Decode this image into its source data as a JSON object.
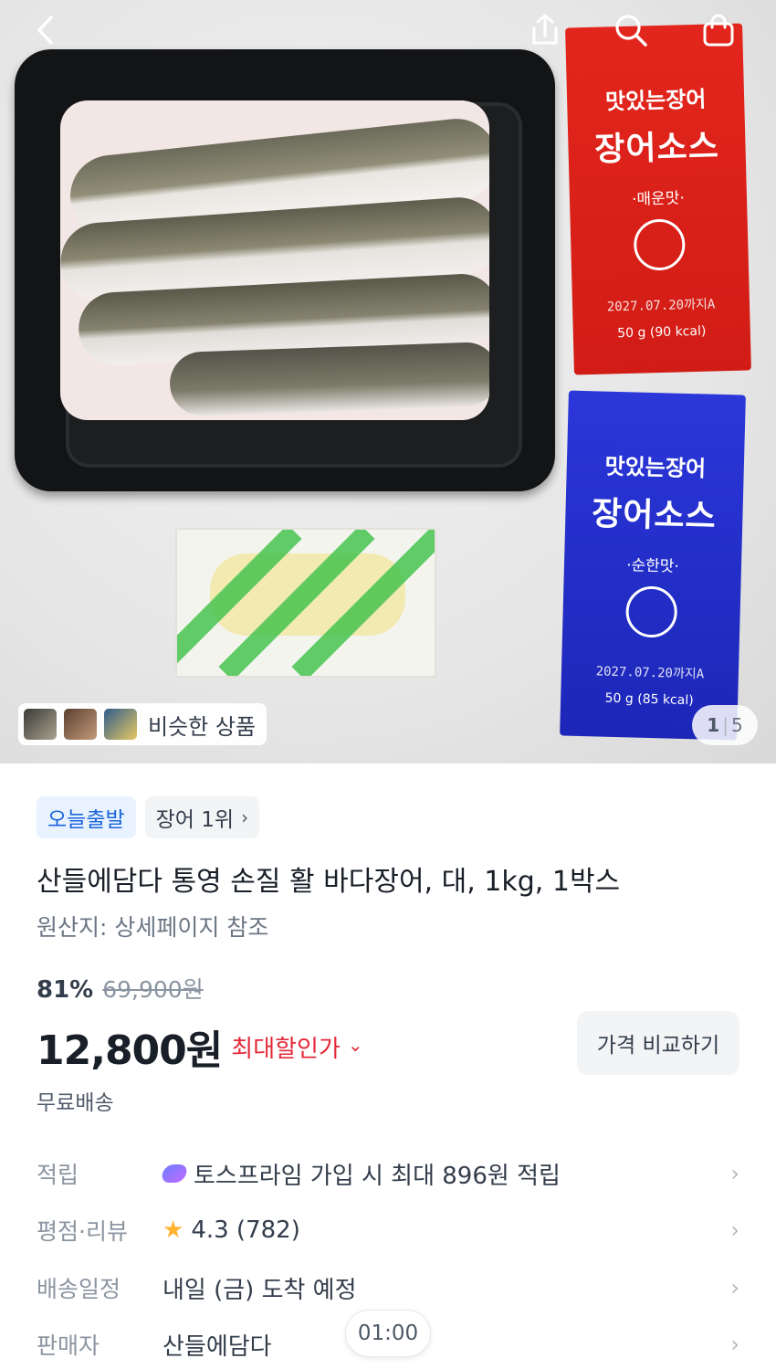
{
  "gallery": {
    "similar_label": "비슷한 상품",
    "counter_current": "1",
    "counter_total": "5",
    "red_sauce": {
      "brand": "맛있는장어",
      "name": "장어소스",
      "flavor": "·매운맛·",
      "expiry": "2027.07.20까지A",
      "weight": "50 g (90 kcal)"
    },
    "blue_sauce": {
      "brand": "맛있는장어",
      "name": "장어소스",
      "flavor": "·순한맛·",
      "expiry": "2027.07.20까지A",
      "weight": "50 g (85 kcal)"
    }
  },
  "tags": {
    "today_ship": "오늘출발",
    "rank": "장어 1위"
  },
  "product": {
    "title": "산들에담다 통영 손질 활 바다장어, 대, 1kg, 1박스",
    "origin": "원산지: 상세페이지 참조",
    "discount_rate": "81%",
    "original_price": "69,900원",
    "price": "12,800원",
    "max_discount_label": "최대할인가",
    "compare_button": "가격 비교하기",
    "shipping": "무료배송"
  },
  "info_rows": {
    "points_label": "적립",
    "points_value": "토스프라임 가입 시 최대 896원 적립",
    "rating_label": "평점·리뷰",
    "rating_value": "4.3 (782)",
    "delivery_label": "배송일정",
    "delivery_value": "내일 (금) 도착 예정",
    "seller_label": "판매자",
    "seller_value": "산들에담다"
  },
  "timer": "01:00",
  "colors": {
    "accent_blue": "#1b64da",
    "discount_red": "#e42939",
    "star": "#ffb331"
  }
}
